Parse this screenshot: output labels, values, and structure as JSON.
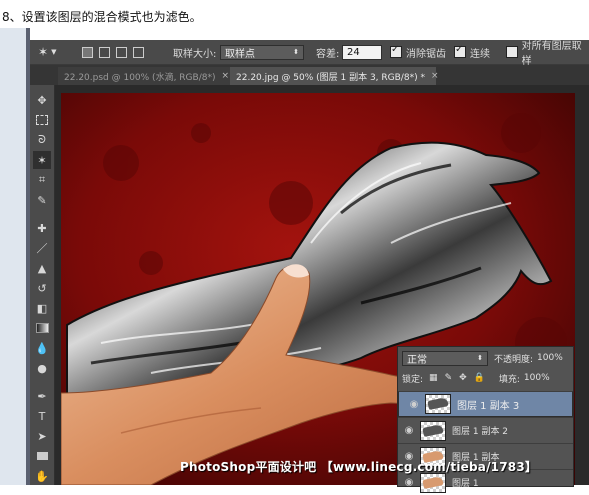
{
  "instruction": "8、设置该图层的混合模式也为滤色。",
  "options_bar": {
    "sample_size_label": "取样大小:",
    "sample_size_value": "取样点",
    "tolerance_label": "容差:",
    "tolerance_value": "24",
    "antialias_label": "消除锯齿",
    "antialias_checked": true,
    "contiguous_label": "连续",
    "contiguous_checked": true,
    "all_layers_label": "对所有图层取样",
    "all_layers_checked": false
  },
  "tabs": [
    {
      "label": "22.20.psd @ 100% (水滴, RGB/8*)",
      "close": "×",
      "active": false
    },
    {
      "label": "22.20.jpg @ 50% (图层 1 副本 3, RGB/8*) *",
      "close": "×",
      "active": true
    }
  ],
  "tools": [
    "move-icon",
    "marquee-icon",
    "lasso-icon",
    "magic-wand-icon",
    "crop-icon",
    "eyedropper-icon",
    "healing-brush-icon",
    "brush-icon",
    "clone-stamp-icon",
    "history-brush-icon",
    "eraser-icon",
    "gradient-icon",
    "blur-icon",
    "dodge-icon",
    "pen-icon",
    "type-icon",
    "path-select-icon",
    "rectangle-icon",
    "hand-icon"
  ],
  "layers_panel": {
    "blend_mode": "正常",
    "opacity_label": "不透明度:",
    "opacity_value": "100%",
    "lock_label": "锁定:",
    "fill_label": "填充:",
    "fill_value": "100%",
    "layers": [
      {
        "name": "图层 1 副本 3",
        "selected": true
      },
      {
        "name": "图层 1 副本 2",
        "selected": false
      },
      {
        "name": "图层 1 副本",
        "selected": false
      },
      {
        "name": "图层 1",
        "selected": false
      }
    ]
  },
  "watermark": "PhotoShop平面设计吧 【www.linecg.com/tieba/1783】",
  "colors": {
    "ui_dark": "#4a4a4a",
    "selected_layer": "#6f86a6",
    "canvas_background": "#7a0a08"
  }
}
